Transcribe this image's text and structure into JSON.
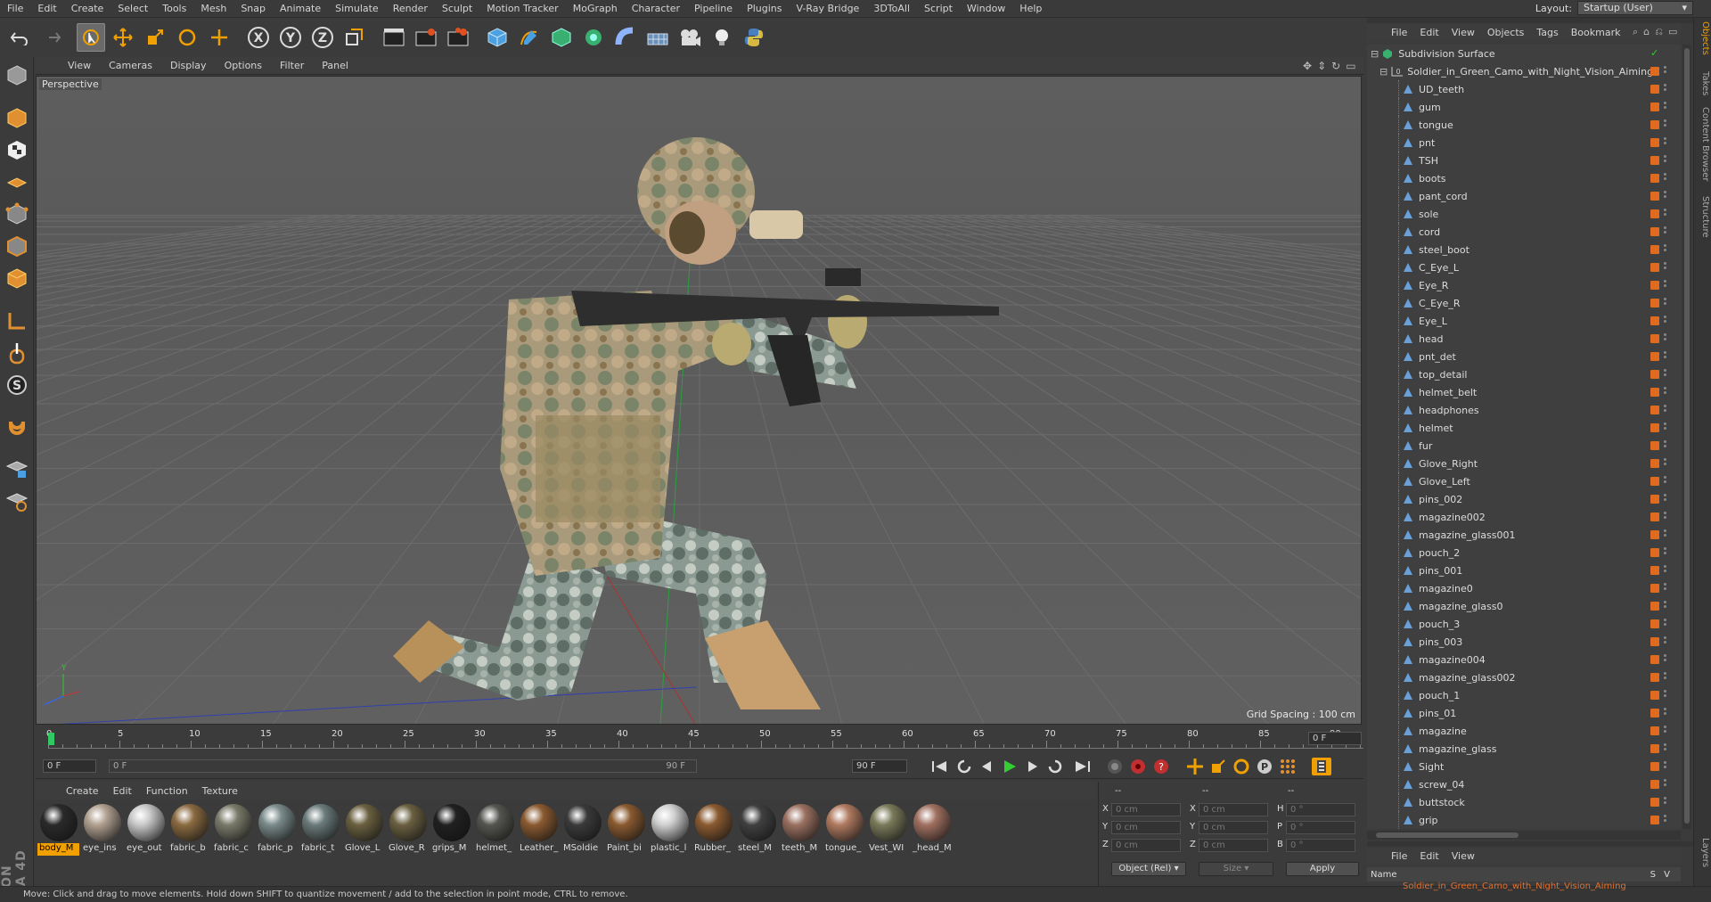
{
  "menubar": {
    "items": [
      "File",
      "Edit",
      "Create",
      "Select",
      "Tools",
      "Mesh",
      "Snap",
      "Animate",
      "Simulate",
      "Render",
      "Sculpt",
      "Motion Tracker",
      "MoGraph",
      "Character",
      "Pipeline",
      "Plugins",
      "V-Ray Bridge",
      "3DToAll",
      "Script",
      "Window",
      "Help"
    ],
    "layout_label": "Layout:",
    "layout_value": "Startup (User)"
  },
  "viewport": {
    "menu": [
      "View",
      "Cameras",
      "Display",
      "Options",
      "Filter",
      "Panel"
    ],
    "label": "Perspective",
    "grid_spacing": "Grid Spacing : 100 cm"
  },
  "timeline": {
    "ticks": [
      "0",
      "5",
      "10",
      "15",
      "20",
      "25",
      "30",
      "35",
      "40",
      "45",
      "50",
      "55",
      "60",
      "65",
      "70",
      "75",
      "80",
      "85",
      "90"
    ],
    "current": "0 F"
  },
  "transport": {
    "start": "0 F",
    "range_start": "0 F",
    "range_end": "90 F",
    "end": "90 F"
  },
  "materials": {
    "menu": [
      "Create",
      "Edit",
      "Function",
      "Texture"
    ],
    "items": [
      {
        "label": "body_M",
        "color": "#2a2a2a",
        "sel": true
      },
      {
        "label": "eye_ins",
        "color": "#b0a090"
      },
      {
        "label": "eye_out",
        "color": "#c8c8c8"
      },
      {
        "label": "fabric_b",
        "color": "#8a6a40"
      },
      {
        "label": "fabric_c",
        "color": "#7a7a6a"
      },
      {
        "label": "fabric_p",
        "color": "#7a8a8a"
      },
      {
        "label": "fabric_t",
        "color": "#6a7a7a"
      },
      {
        "label": "Glove_L",
        "color": "#6a6040"
      },
      {
        "label": "Glove_R",
        "color": "#6a6040"
      },
      {
        "label": "grips_M",
        "color": "#202020"
      },
      {
        "label": "helmet_",
        "color": "#555550"
      },
      {
        "label": "Leather_",
        "color": "#8a5a30"
      },
      {
        "label": "MSoldie",
        "color": "#3a3a3a"
      },
      {
        "label": "Paint_bi",
        "color": "#8a5a30"
      },
      {
        "label": "plastic_l",
        "color": "#d0d0d0"
      },
      {
        "label": "Rubber_",
        "color": "#8a5a30"
      },
      {
        "label": "steel_M",
        "color": "#404040"
      },
      {
        "label": "teeth_M",
        "color": "#9a7060"
      },
      {
        "label": "tongue_",
        "color": "#b07a60"
      },
      {
        "label": "Vest_WI",
        "color": "#7a7a5a"
      },
      {
        "label": "_head_M",
        "color": "#a07060"
      }
    ]
  },
  "coords": {
    "header": [
      "--",
      "--",
      "--"
    ],
    "rows": [
      {
        "a": "X",
        "av": "0 cm",
        "b": "X",
        "bv": "0 cm",
        "c": "H",
        "cv": "0 °"
      },
      {
        "a": "Y",
        "av": "0 cm",
        "b": "Y",
        "bv": "0 cm",
        "c": "P",
        "cv": "0 °"
      },
      {
        "a": "Z",
        "av": "0 cm",
        "b": "Z",
        "bv": "0 cm",
        "c": "B",
        "cv": "0 °"
      }
    ],
    "mode": "Object (Rel)",
    "size": "Size",
    "apply": "Apply"
  },
  "status": "Move: Click and drag to move elements. Hold down SHIFT to quantize movement / add to the selection in point mode, CTRL to remove.",
  "object_manager": {
    "menu": [
      "File",
      "Edit",
      "View",
      "Objects",
      "Tags",
      "Bookmark"
    ],
    "root": "Subdivision Surface",
    "group": "Soldier_in_Green_Camo_with_Night_Vision_Aiming",
    "items": [
      "UD_teeth",
      "gum",
      "tongue",
      "pnt",
      "TSH",
      "boots",
      "pant_cord",
      "sole",
      "cord",
      "steel_boot",
      "C_Eye_L",
      "Eye_R",
      "C_Eye_R",
      "Eye_L",
      "head",
      "pnt_det",
      "top_detail",
      "helmet_belt",
      "headphones",
      "helmet",
      "fur",
      "Glove_Right",
      "Glove_Left",
      "pins_002",
      "magazine002",
      "magazine_glass001",
      "pouch_2",
      "pins_001",
      "magazine0",
      "magazine_glass0",
      "pouch_3",
      "pins_003",
      "magazine004",
      "magazine_glass002",
      "pouch_1",
      "pins_01",
      "magazine",
      "magazine_glass",
      "Sight",
      "screw_04",
      "buttstock",
      "grip"
    ]
  },
  "layer_manager": {
    "menu": [
      "File",
      "Edit",
      "View"
    ],
    "name_col": "Name",
    "col_s": "S",
    "col_v": "V",
    "row": "Soldier_in_Green_Camo_with_Night_Vision_Aiming"
  },
  "right_tabs": [
    "Objects",
    "Takes",
    "Content Browser",
    "Structure",
    "Layers"
  ]
}
